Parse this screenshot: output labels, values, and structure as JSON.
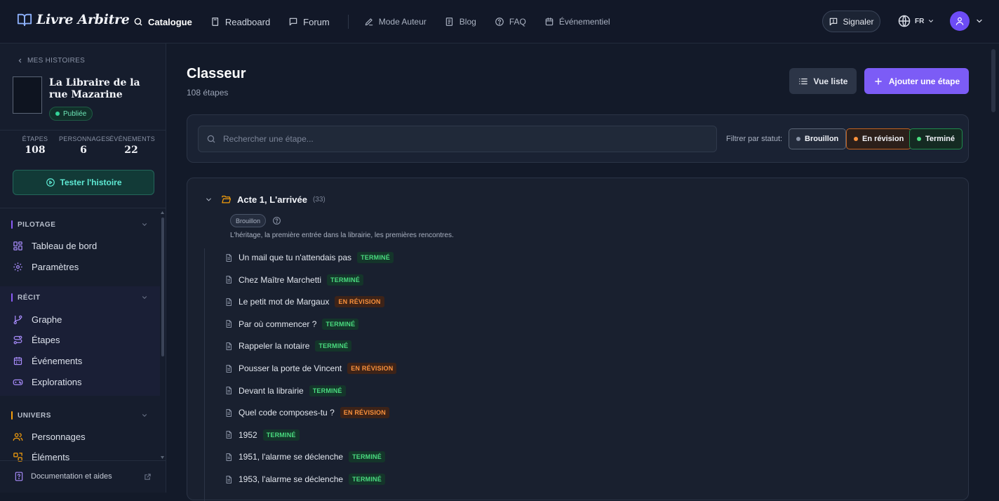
{
  "app": {
    "name": "Livre Arbitre"
  },
  "nav": {
    "items": [
      {
        "label": "Catalogue"
      },
      {
        "label": "Readboard"
      },
      {
        "label": "Forum"
      },
      {
        "label": "Mode Auteur"
      },
      {
        "label": "Blog"
      },
      {
        "label": "FAQ"
      },
      {
        "label": "Événementiel"
      }
    ],
    "report_label": "Signaler",
    "lang": "FR"
  },
  "sidebar": {
    "back_label": "MES HISTOIRES",
    "story_title": "La Libraire de la rue Mazarine",
    "status_badge": "Publiée",
    "stats": [
      {
        "label": "ÉTAPES",
        "value": "108"
      },
      {
        "label": "PERSONNAGES",
        "value": "6"
      },
      {
        "label": "ÉVÉNEMENTS",
        "value": "22"
      }
    ],
    "test_button": "Tester l'histoire",
    "sections": [
      {
        "title": "PILOTAGE",
        "items": [
          "Tableau de bord",
          "Paramètres"
        ]
      },
      {
        "title": "RÉCIT",
        "items": [
          "Graphe",
          "Étapes",
          "Événements",
          "Explorations"
        ]
      },
      {
        "title": "UNIVERS",
        "items": [
          "Personnages",
          "Éléments"
        ]
      }
    ],
    "doc_link": "Documentation et aides"
  },
  "main": {
    "title": "Classeur",
    "subtitle": "108 étapes",
    "list_view_button": "Vue liste",
    "add_step_button": "Ajouter une étape",
    "search_placeholder": "Rechercher une étape...",
    "filter_label": "Filtrer par statut:",
    "filters": [
      "Brouillon",
      "En révision",
      "Terminé"
    ],
    "act": {
      "title": "Acte 1, L'arrivée",
      "count": "(33)",
      "status": "Brouillon",
      "description": "L'héritage, la première entrée dans la librairie, les premières rencontres.",
      "steps": [
        {
          "title": "Un mail que tu n'attendais pas",
          "status": "TERMINÉ",
          "kind": "done"
        },
        {
          "title": "Chez Maître Marchetti",
          "status": "TERMINÉ",
          "kind": "done"
        },
        {
          "title": "Le petit mot de Margaux",
          "status": "EN RÉVISION",
          "kind": "rev"
        },
        {
          "title": "Par où commencer ?",
          "status": "TERMINÉ",
          "kind": "done"
        },
        {
          "title": "Rappeler la notaire",
          "status": "TERMINÉ",
          "kind": "done"
        },
        {
          "title": "Pousser la porte de Vincent",
          "status": "EN RÉVISION",
          "kind": "rev"
        },
        {
          "title": "Devant la librairie",
          "status": "TERMINÉ",
          "kind": "done"
        },
        {
          "title": "Quel code composes-tu ?",
          "status": "EN RÉVISION",
          "kind": "rev"
        },
        {
          "title": "1952",
          "status": "TERMINÉ",
          "kind": "done"
        },
        {
          "title": "1951, l'alarme se déclenche",
          "status": "TERMINÉ",
          "kind": "done"
        },
        {
          "title": "1953, l'alarme se déclenche",
          "status": "TERMINÉ",
          "kind": "done"
        }
      ]
    }
  },
  "colors": {
    "accent": "#7c5cf6",
    "done": "#4ade80",
    "review": "#fb923c",
    "teal": "#5eead4"
  }
}
